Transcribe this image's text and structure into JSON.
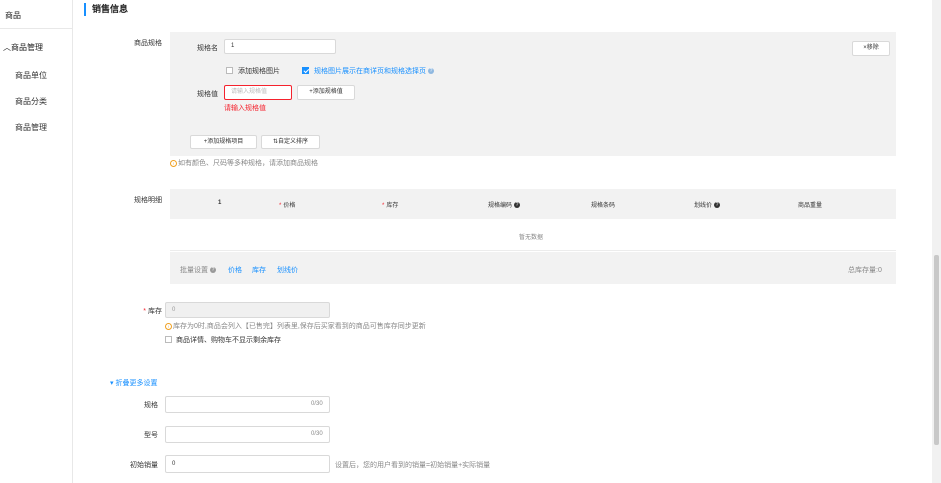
{
  "sidebar": {
    "top_label": "商品",
    "group_label": "商品管理",
    "group_chevron": "chevron-up-icon",
    "items": [
      {
        "label": "商品单位"
      },
      {
        "label": "商品分类"
      },
      {
        "label": "商品管理"
      }
    ]
  },
  "section": {
    "title": "销售信息",
    "accent": "#1890ff"
  },
  "spec": {
    "label": "商品规格",
    "name_label": "规格名",
    "name_value": "1",
    "remove_label": "×移除",
    "add_image_label": "添加规格图片",
    "show_image_label": "规格图片展示在商详页和规格选择页",
    "value_label": "规格值",
    "value_placeholder": "请输入规格值",
    "value_error": "请输入规格值",
    "add_value_label": "+添加规格值",
    "add_item_label": "+添加规格项目",
    "custom_sort_label": "自定义排序",
    "hint": "如有颜色、尺码等多种规格，请添加商品规格"
  },
  "detail": {
    "label": "规格明细",
    "columns": [
      "1",
      "价格",
      "库存",
      "规格编码",
      "规格条码",
      "划线价",
      "商品重量"
    ],
    "empty": "暂无数据",
    "batch_label": "批量设置",
    "batch_links": [
      "价格",
      "库存",
      "划线价"
    ],
    "total_stock": "总库存量:0"
  },
  "stock": {
    "label": "库存",
    "value": "0",
    "hint": "库存为0时,商品会列入【已售完】列表里,保存后买家看到的商品可售库存同步更新",
    "hide_label": "商品详情、购物车不显示剩余库存"
  },
  "more": {
    "toggle_label": "折叠更多设置"
  },
  "fields": [
    {
      "label": "规格",
      "value": "",
      "counter": "0/30"
    },
    {
      "label": "型号",
      "value": "",
      "counter": "0/30"
    },
    {
      "label": "初始销量",
      "value": "0",
      "hint": "设置后，您的用户看到的销量=初始销量+实际销量"
    }
  ],
  "colors": {
    "primary": "#1890ff",
    "error": "#f5222d",
    "warning": "#f0a020"
  }
}
